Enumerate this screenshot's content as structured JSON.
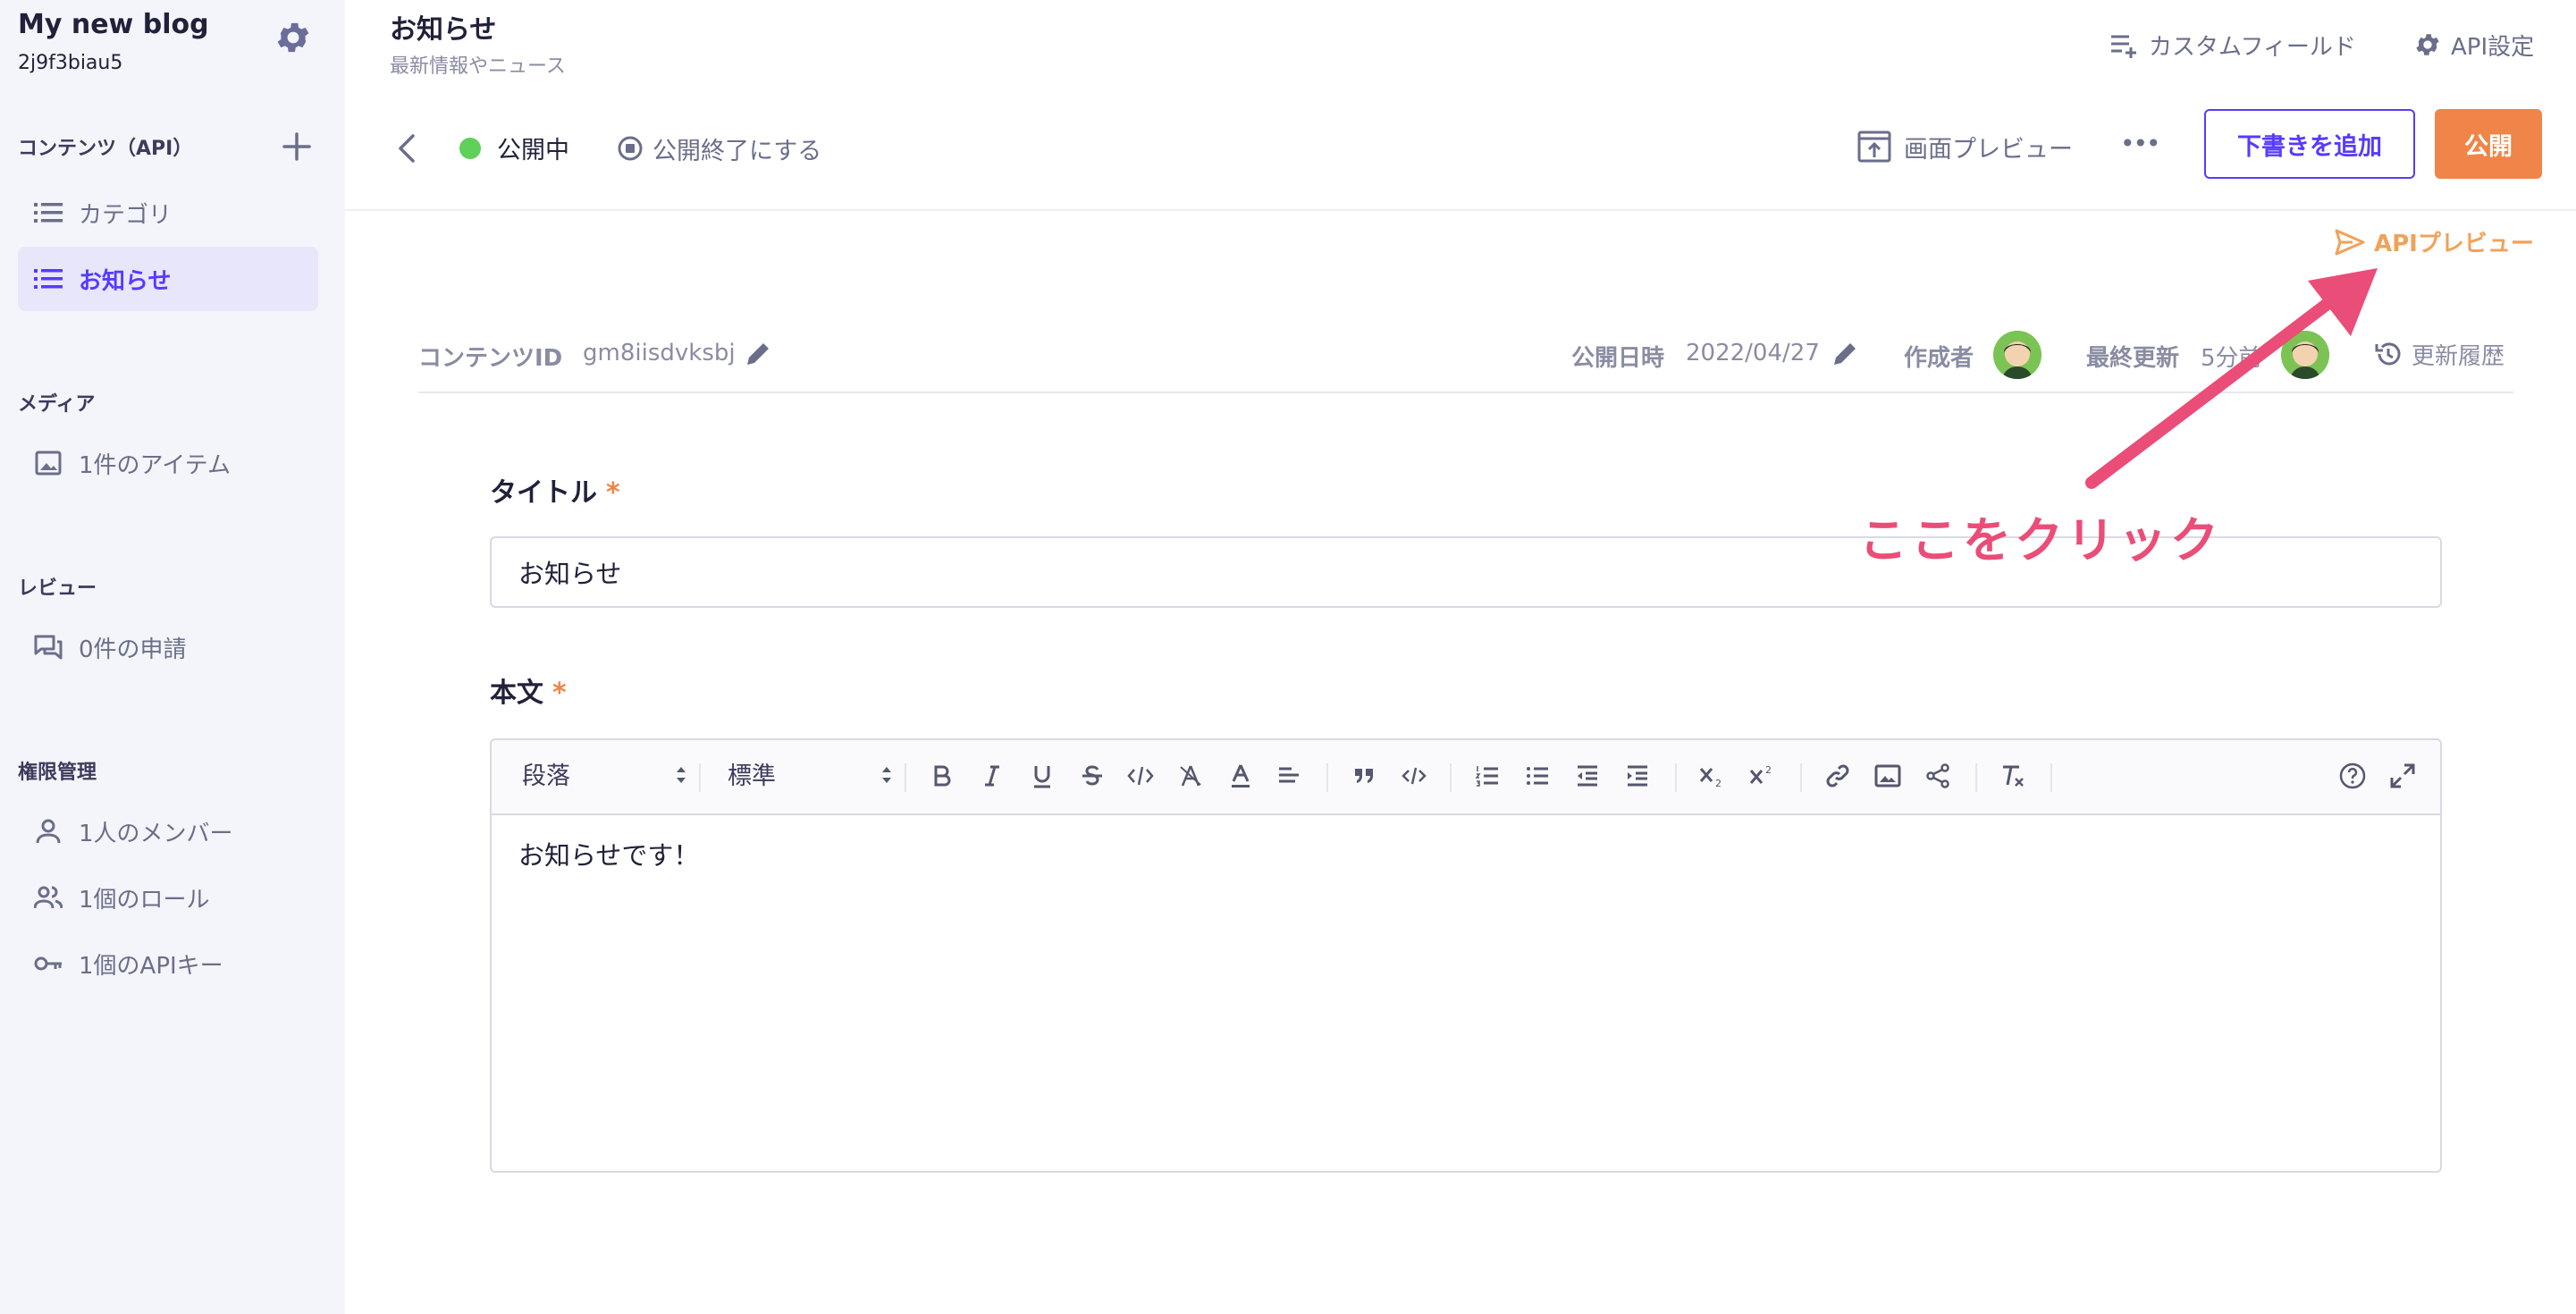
{
  "sidebar": {
    "app_name": "My new blog",
    "service_id": "2j9f3biau5",
    "sections": {
      "contents": "コンテンツ（API）",
      "media": "メディア",
      "review": "レビュー",
      "permissions": "権限管理"
    },
    "items": {
      "category": "カテゴリ",
      "news": "お知らせ",
      "media_items": "1件のアイテム",
      "review_requests": "0件の申請",
      "members": "1人のメンバー",
      "roles": "1個のロール",
      "api_keys": "1個のAPIキー"
    }
  },
  "header": {
    "title": "お知らせ",
    "subtitle": "最新情報やニュース",
    "custom_field": "カスタムフィールド",
    "api_settings": "API設定"
  },
  "status_bar": {
    "status": "公開中",
    "unpublish": "公開終了にする",
    "screen_preview": "画面プレビュー",
    "more": "•••",
    "add_draft": "下書きを追加",
    "publish": "公開",
    "api_preview": "APIプレビュー"
  },
  "meta": {
    "content_id_label": "コンテンツID",
    "content_id": "gm8iisdvksbj",
    "published_at_label": "公開日時",
    "published_at": "2022/04/27",
    "author_label": "作成者",
    "updated_label": "最終更新",
    "updated": "5分前",
    "history": "更新履歴"
  },
  "form": {
    "title_label": "タイトル",
    "title_value": "お知らせ",
    "body_label": "本文",
    "required_mark": "*",
    "paragraph_select": "段落",
    "size_select": "標準",
    "body_value": "お知らせです！"
  },
  "annotation": {
    "text": "ここをクリック",
    "color": "#ea4d77"
  },
  "colors": {
    "accent": "#563bff",
    "publish": "#ef8548",
    "status_green": "#5fd05a",
    "api_preview": "#f0a25a"
  }
}
